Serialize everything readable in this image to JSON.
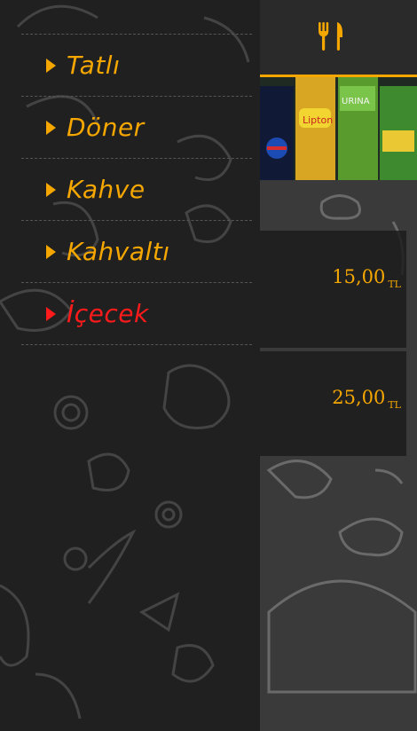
{
  "sidebar": {
    "items": [
      {
        "label": "Tatlı",
        "active": false
      },
      {
        "label": "Döner",
        "active": false
      },
      {
        "label": "Kahve",
        "active": false
      },
      {
        "label": "Kahvaltı",
        "active": false
      },
      {
        "label": "İçecek",
        "active": true
      }
    ]
  },
  "header": {
    "icon": "fork-knife-icon"
  },
  "banner": {
    "image": "soft-drink-bottles-image"
  },
  "products": [
    {
      "price": "15,00",
      "currency": "TL"
    },
    {
      "price": "25,00",
      "currency": "TL"
    }
  ],
  "colors": {
    "accent": "#f5a700",
    "active": "#ff1b1b",
    "sidebar_bg": "#202020",
    "panel_bg": "#3a3a3a"
  }
}
